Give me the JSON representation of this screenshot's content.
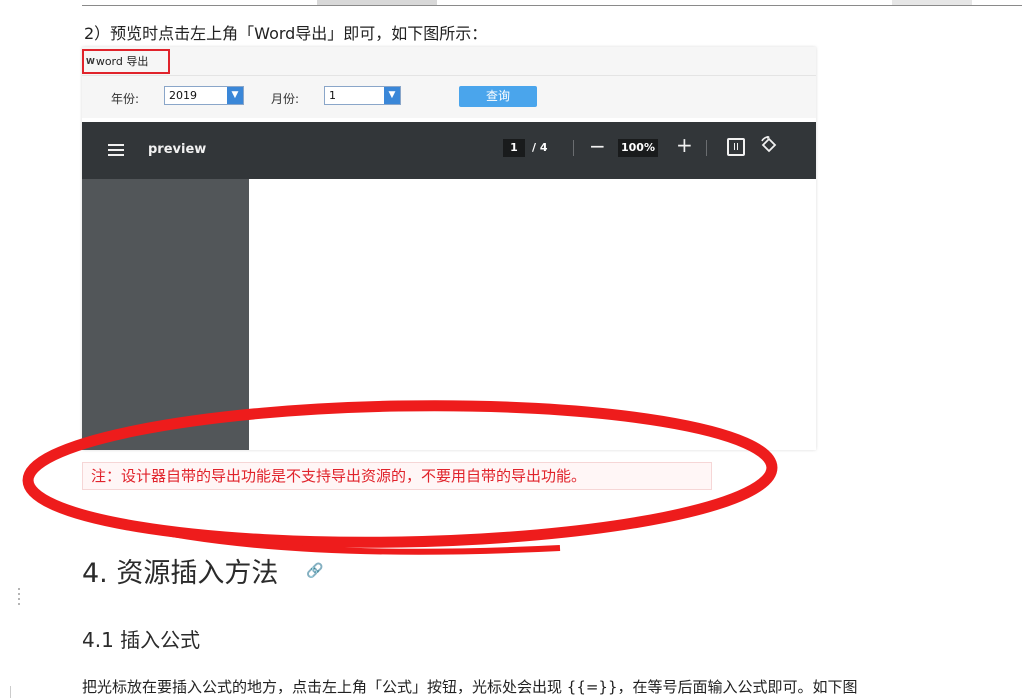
{
  "step": {
    "text": "2）预览时点击左上角「Word导出」即可，如下图所示："
  },
  "shot": {
    "word_button": {
      "icon": "W",
      "label": "word 导出"
    },
    "year": {
      "label": "年份:",
      "value": "2019"
    },
    "month": {
      "label": "月份:",
      "value": "1"
    },
    "query_button": "查询",
    "viewer": {
      "title": "preview",
      "page_current": "1",
      "page_total": "/ 4",
      "zoom": "100%"
    }
  },
  "note": "注：设计器自带的导出功能是不支持导出资源的，不要用自带的导出功能。",
  "section": {
    "title": "4. 资源插入方法",
    "subtitle": "4.1 插入公式",
    "paragraph": "把光标放在要插入公式的地方，点击左上角「公式」按钮，光标处会出现 {{=}}，在等号后面输入公式即可。如下图"
  },
  "colors": {
    "annotation_red": "#e0232b",
    "viewer_bar": "#323639",
    "query_button": "#4aa5ec"
  }
}
